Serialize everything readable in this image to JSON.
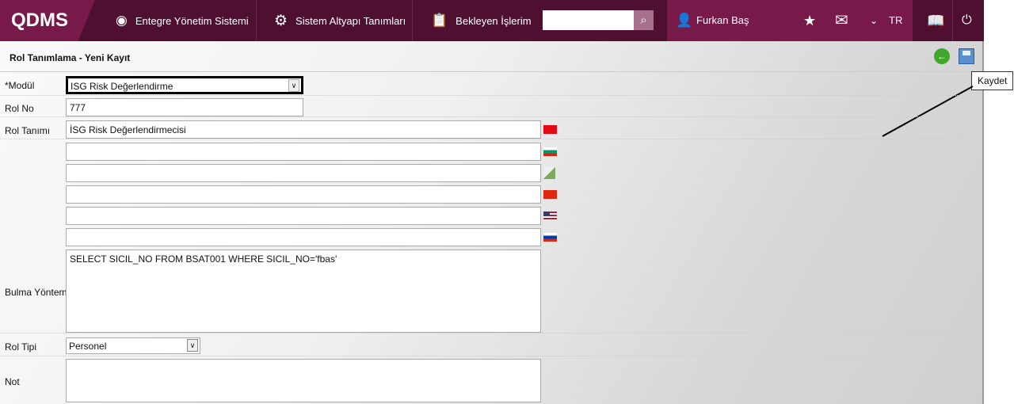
{
  "header": {
    "logo": "QDMS",
    "nav": [
      "Entegre Yönetim Sistemi",
      "Sistem Altyapı Tanımları",
      "Bekleyen İşlerim"
    ],
    "search_value": "",
    "user": "Furkan Baş",
    "lang": "TR"
  },
  "page": {
    "title": "Rol Tanımlama - Yeni Kayıt",
    "tooltip": "Kaydet"
  },
  "form": {
    "modul_label": "*Modül",
    "modul_value": "ISG Risk Değerlendirme",
    "rolno_label": "Rol No",
    "rolno_value": "777",
    "roltanimi_label": "Rol Tanımı",
    "roltanimi_value": "İSG Risk Değerlendirmecisi",
    "bulma_label": "Bulma Yöntemi",
    "bulma_value": "SELECT SICIL_NO FROM BSAT001 WHERE SICIL_NO='fbas'",
    "roltipi_label": "Rol Tipi",
    "roltipi_value": "Personel",
    "not_label": "Not",
    "not_value": ""
  }
}
